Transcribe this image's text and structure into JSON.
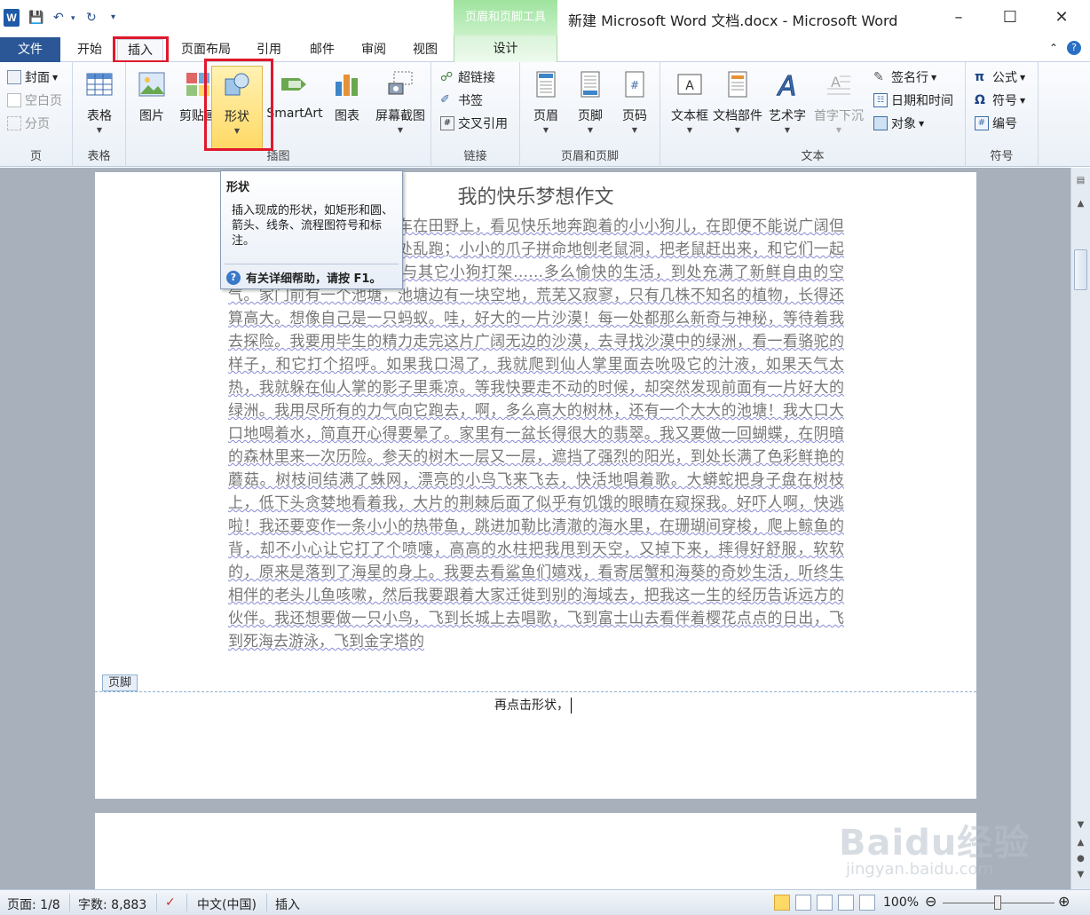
{
  "titlebar": {
    "app_logo": "W",
    "context_tools": "页眉和页脚工具",
    "window_title": "新建 Microsoft Word 文档.docx - Microsoft Word"
  },
  "tabs": {
    "file": "文件",
    "home": "开始",
    "insert": "插入",
    "layout": "页面布局",
    "references": "引用",
    "mailings": "邮件",
    "review": "审阅",
    "view": "视图",
    "design": "设计"
  },
  "ribbon": {
    "pages": {
      "label": "页",
      "cover": "封面",
      "blank": "空白页",
      "break": "分页"
    },
    "tables": {
      "label": "表格",
      "table": "表格"
    },
    "illustrations": {
      "label": "插图",
      "picture": "图片",
      "clipart": "剪贴画",
      "shapes": "形状",
      "smartart": "SmartArt",
      "chart": "图表",
      "screenshot": "屏幕截图"
    },
    "links": {
      "label": "链接",
      "hyperlink": "超链接",
      "bookmark": "书签",
      "crossref": "交叉引用"
    },
    "headerfooter": {
      "label": "页眉和页脚",
      "header": "页眉",
      "footer": "页脚",
      "pagenum": "页码"
    },
    "text": {
      "label": "文本",
      "textbox": "文本框",
      "quickparts": "文档部件",
      "wordart": "艺术字",
      "dropcap": "首字下沉",
      "signature": "签名行",
      "datetime": "日期和时间",
      "object": "对象"
    },
    "symbols": {
      "label": "符号",
      "equation": "公式",
      "symbol": "符号",
      "number": "编号"
    }
  },
  "tooltip": {
    "title": "形状",
    "body": "插入现成的形状，如矩形和圆、箭头、线条、流程图符号和标注。",
    "help": "有关详细帮助，请按 F1。"
  },
  "document": {
    "title": "我的快乐梦想作文",
    "body": "多么渴望心灵的解放。骑车在田野上，看见快乐地奔跑着的小小狗儿，在即便不能说广阔但也很大的田野上兴奋地四处乱跑；小小的爪子拼命地刨老鼠洞，把老鼠赶出来，和它们一起做游戏；为了一块食物而与其它小狗打架……多么愉快的生活，到处充满了新鲜自由的空气。家门前有一个池塘，池塘边有一块空地，荒芜又寂寥，只有几株不知名的植物，长得还算高大。想像自己是一只蚂蚁。哇，好大的一片沙漠！每一处都那么新奇与神秘，等待着我去探险。我要用毕生的精力走完这片广阔无边的沙漠，去寻找沙漠中的绿洲，看一看骆驼的样子，和它打个招呼。如果我口渴了，我就爬到仙人掌里面去吮吸它的汁液，如果天气太热，我就躲在仙人掌的影子里乘凉。等我快要走不动的时候，却突然发现前面有一片好大的绿洲。我用尽所有的力气向它跑去，啊，多么高大的树林，还有一个大大的池塘！我大口大口地喝着水，简直开心得要晕了。家里有一盆长得很大的翡翠。我又要做一回蝴蝶，在阴暗的森林里来一次历险。参天的树木一层又一层，遮挡了强烈的阳光，到处长满了色彩鲜艳的蘑菇。树枝间结满了蛛网，漂亮的小鸟飞来飞去，快活地唱着歌。大蟒蛇把身子盘在树枝上，低下头贪婪地看着我，大片的荆棘后面了似乎有饥饿的眼睛在窥探我。好吓人啊，快逃啦！我还要变作一条小小的热带鱼，跳进加勒比清澈的海水里，在珊瑚间穿梭，爬上鲸鱼的背，却不小心让它打了个喷嚏，高高的水柱把我甩到天空，又掉下来，摔得好舒服，软软的，原来是落到了海星的身上。我要去看鲨鱼们嬉戏，看寄居蟹和海葵的奇妙生活，听终生相伴的老头儿鱼咳嗽，然后我要跟着大家迁徙到别的海域去，把我这一生的经历告诉远方的伙伴。我还想要做一只小鸟，飞到长城上去唱歌，飞到富士山去看伴着樱花点点的日出，飞到死海去游泳，飞到金字塔的",
    "footer_tag": "页脚",
    "footer_text": "再点击形状，"
  },
  "status": {
    "page": "页面: 1/8",
    "words": "字数: 8,883",
    "lang": "中文(中国)",
    "mode": "插入",
    "zoom": "100%"
  },
  "watermark": {
    "logo": "Baidu经验",
    "url": "jingyan.baidu.com"
  }
}
